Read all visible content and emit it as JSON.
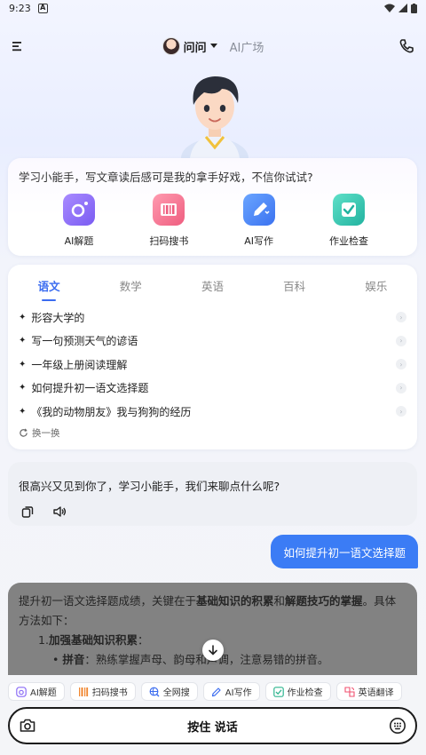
{
  "status_bar": {
    "time": "9:23"
  },
  "nav": {
    "persona_name": "问问",
    "plaza_label": "AI广场"
  },
  "intro": {
    "text": "学习小能手，写文章读后感可是我的拿手好戏，不信你试试?",
    "tools": [
      {
        "label": "AI解题",
        "icon": "camera-solve-icon",
        "color": "#8b6cf6"
      },
      {
        "label": "扫码搜书",
        "icon": "barcode-icon",
        "color": "#f06f8a"
      },
      {
        "label": "AI写作",
        "icon": "pen-icon",
        "color": "#4b8af5"
      },
      {
        "label": "作业检查",
        "icon": "check-icon",
        "color": "#2fc4b2"
      }
    ]
  },
  "subjects": {
    "tabs": [
      "语文",
      "数学",
      "英语",
      "百科",
      "娱乐"
    ],
    "active_tab": "语文",
    "questions": [
      "形容大学的",
      "写一句预测天气的谚语",
      "一年级上册阅读理解",
      "如何提升初一语文选择题",
      "《我的动物朋友》我与狗狗的经历"
    ],
    "refresh_label": "换一换"
  },
  "chat": {
    "greeting": "很高兴又见到你了，学习小能手，我们来聊点什么呢?",
    "user_message": "如何提升初一语文选择题",
    "answer": {
      "p1_start": "提升初一语文选择题成绩，关键在于",
      "p1_bold1": "基础知识的积累",
      "p1_mid": "和",
      "p1_bold2": "解题技巧的掌握",
      "p1_end": "。具体方法如下：",
      "item1_num": "1.",
      "item1_title": "加强基础知识积累",
      "item1_colon": "：",
      "sub1_bold": "拼音",
      "sub1_text": "：熟练掌握声母、韵母和声调，注意易错的拼音。"
    }
  },
  "quick_chips": [
    {
      "label": "AI解题",
      "icon": "camera-solve-icon",
      "color": "#8b6cf6"
    },
    {
      "label": "扫码搜书",
      "icon": "barcode-icon",
      "color": "#f0862f"
    },
    {
      "label": "全网搜",
      "icon": "web-search-icon",
      "color": "#3b6cf0"
    },
    {
      "label": "AI写作",
      "icon": "pen-icon",
      "color": "#3b6cf0"
    },
    {
      "label": "作业检查",
      "icon": "check-icon",
      "color": "#2fb58f"
    },
    {
      "label": "英语翻译",
      "icon": "translate-icon",
      "color": "#f0506f"
    }
  ],
  "input": {
    "hold_to_talk": "按住 说话"
  }
}
